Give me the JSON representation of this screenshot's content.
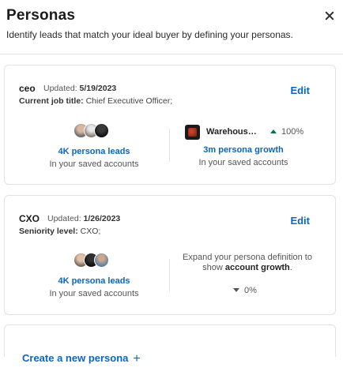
{
  "header": {
    "title": "Personas",
    "subtitle": "Identify leads that match your ideal buyer by defining your personas."
  },
  "personas": [
    {
      "name": "ceo",
      "updated_label": "Updated:",
      "updated_date": "5/19/2023",
      "detail_label": "Current job title:",
      "detail_value": "Chief Executive Officer;",
      "edit_label": "Edit",
      "leads_link": "4K persona leads",
      "leads_sub": "In your saved accounts",
      "company_name": "Warehous…",
      "growth_pct": "100%",
      "growth_link": "3m persona growth",
      "growth_sub": "In your saved accounts"
    },
    {
      "name": "CXO",
      "updated_label": "Updated:",
      "updated_date": "1/26/2023",
      "detail_label": "Seniority level:",
      "detail_value": "CXO;",
      "edit_label": "Edit",
      "leads_link": "4K persona leads",
      "leads_sub": "In your saved accounts",
      "expand_text": "Expand your persona definition to show",
      "expand_bold": "account growth",
      "growth_pct": "0%"
    }
  ],
  "footer": {
    "create_label": "Create a new persona",
    "create_icon": "+"
  },
  "colors": {
    "link": "#0a66c2",
    "growth_up": "#057642"
  }
}
